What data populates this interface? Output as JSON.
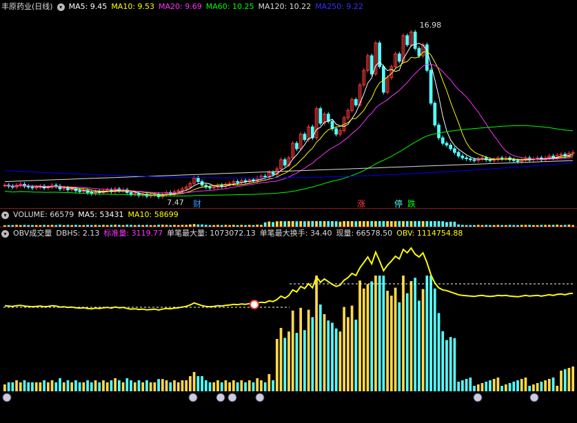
{
  "header": {
    "stock_title": "丰原药业(日线)",
    "ma5_label": "MA5: 9.45",
    "ma10_label": "MA10: 9.53",
    "ma20_label": "MA20: 9.69",
    "ma60_label": "MA60: 10.25",
    "ma120_label": "MA120: 10.22",
    "ma250_label": "MA250: 9.22",
    "price_high": "16.98",
    "price_low": "7.47",
    "markers": {
      "cai": "财",
      "zhang": "涨",
      "ting": "停",
      "die": "跌"
    }
  },
  "volume": {
    "title": "VOLUME: 66579",
    "ma5": "MA5: 53431",
    "ma10": "MA10: 58699"
  },
  "obv": {
    "title": "OBV成交量",
    "dbhs": "DBHS: 2.13",
    "std_label": "标准量: 3119.77",
    "max_single": "单笔最大量: 1073072.13",
    "max_turnover": "单笔最大换手: 34.40",
    "current": "现量: 66578.50",
    "obv_val": "OBV: 1114754.88"
  },
  "colors": {
    "up": "#ff3b3b",
    "down": "#54ffff",
    "ma5": "#ffffff",
    "ma10": "#ffff00",
    "ma20": "#ff33ff",
    "ma60": "#00ff00",
    "ma120": "#dddddd",
    "ma250": "#0000ff",
    "obv_line": "#ffff00",
    "vol_yellow": "#ffd84a"
  },
  "chart_data": [
    {
      "type": "candlestick",
      "title": "丰原药业(日线)",
      "y_annotations": {
        "high": 16.98,
        "low": 7.47
      },
      "ylim": [
        7.0,
        17.5
      ],
      "series": [
        {
          "name": "MA5",
          "last": 9.45
        },
        {
          "name": "MA10",
          "last": 9.53
        },
        {
          "name": "MA20",
          "last": 9.69
        },
        {
          "name": "MA60",
          "last": 10.25
        },
        {
          "name": "MA120",
          "last": 10.22
        },
        {
          "name": "MA250",
          "last": 9.22
        }
      ],
      "candles_c": [
        8.1,
        8.05,
        8.0,
        8.1,
        8.15,
        8.05,
        8.0,
        7.95,
        8.0,
        8.05,
        7.95,
        8.0,
        8.1,
        8.05,
        7.9,
        7.95,
        7.85,
        7.9,
        7.8,
        7.75,
        7.8,
        7.7,
        7.65,
        7.75,
        7.7,
        7.8,
        7.85,
        7.75,
        7.9,
        7.8,
        7.85,
        7.7,
        7.6,
        7.65,
        7.55,
        7.6,
        7.5,
        7.55,
        7.6,
        7.47,
        7.6,
        7.7,
        7.65,
        7.75,
        7.8,
        7.9,
        8.0,
        8.2,
        8.5,
        8.3,
        8.1,
        8.0,
        7.95,
        8.0,
        8.1,
        8.05,
        8.15,
        8.2,
        8.3,
        8.25,
        8.35,
        8.3,
        8.4,
        8.35,
        8.5,
        8.6,
        8.55,
        8.8,
        8.7,
        9.0,
        9.5,
        9.2,
        9.6,
        10.4,
        10.1,
        10.9,
        10.6,
        11.3,
        10.7,
        12.3,
        11.5,
        12.0,
        11.6,
        11.2,
        10.9,
        11.1,
        11.8,
        12.2,
        12.8,
        12.5,
        13.6,
        14.4,
        15.2,
        14.2,
        15.9,
        14.6,
        13.2,
        14.0,
        14.6,
        15.3,
        14.9,
        16.3,
        15.8,
        16.5,
        15.6,
        15.2,
        15.8,
        14.4,
        12.6,
        11.4,
        10.7,
        10.4,
        10.3,
        10.1,
        9.9,
        9.7,
        9.6,
        9.55,
        9.5,
        9.45,
        9.55,
        9.6,
        9.5,
        9.45,
        9.5,
        9.6,
        9.55,
        9.6,
        9.5,
        9.45,
        9.4,
        9.5,
        9.6,
        9.5,
        9.55,
        9.6,
        9.5,
        9.6,
        9.7,
        9.6,
        9.75,
        9.8,
        9.7,
        9.85,
        9.9
      ]
    },
    {
      "type": "bar",
      "title": "VOLUME: 66579",
      "series": [
        {
          "name": "MA5",
          "last": 53431
        },
        {
          "name": "MA10",
          "last": 58699
        }
      ]
    },
    {
      "type": "line",
      "title": "OBV成交量",
      "series": [
        {
          "name": "OBV",
          "last": 1114754.88
        },
        {
          "name": "现量",
          "last": 66578.5
        }
      ]
    }
  ]
}
